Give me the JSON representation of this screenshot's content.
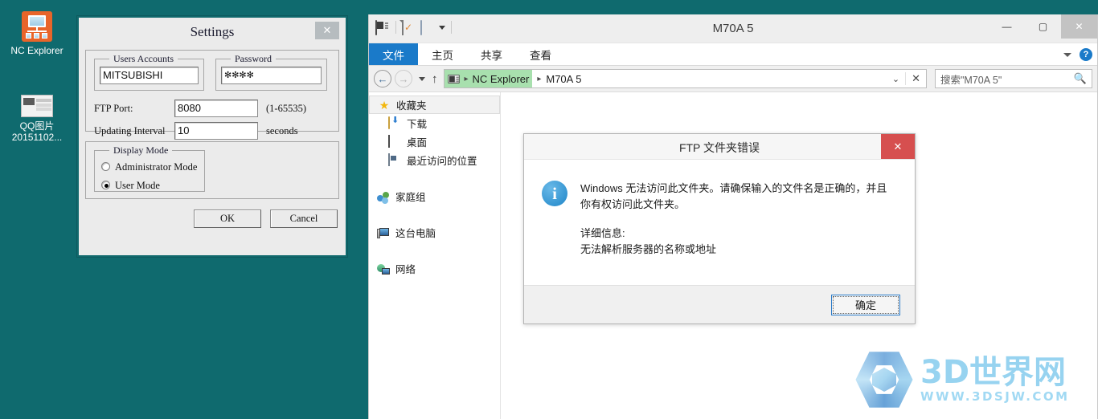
{
  "desktop": {
    "background_color": "#0f6a6e",
    "icons": [
      {
        "name": "NC Explorer",
        "icon": "network-computer-icon"
      },
      {
        "name": "QQ图片\n20151102...",
        "line1": "QQ图片",
        "line2": "20151102...",
        "icon": "image-file-icon"
      }
    ]
  },
  "settings_dialog": {
    "title": "Settings",
    "close_label": "✕",
    "users_accounts": {
      "legend": "Users Accounts",
      "value": "MITSUBISHI"
    },
    "password": {
      "legend": "Password",
      "value": "✻✻✻✻"
    },
    "ftp_port": {
      "label": "FTP Port:",
      "value": "8080",
      "hint": "(1-65535)"
    },
    "updating_interval": {
      "label": "Updating Interval",
      "value": "10",
      "unit": "seconds"
    },
    "display_mode": {
      "legend": "Display Mode",
      "options": [
        {
          "label": "Administrator Mode",
          "selected": false
        },
        {
          "label": "User Mode",
          "selected": true
        }
      ]
    },
    "buttons": {
      "ok": "OK",
      "cancel": "Cancel"
    }
  },
  "explorer": {
    "title": "M70A 5",
    "quick_access": [
      {
        "icon": "explorer-icon"
      },
      {
        "icon": "properties-icon"
      },
      {
        "icon": "new-folder-icon"
      },
      {
        "icon": "customize-dropdown-icon"
      }
    ],
    "window_controls": {
      "minimize": "—",
      "maximize": "▢",
      "close": "✕"
    },
    "ribbon_tabs": [
      {
        "label": "文件",
        "selected": true
      },
      {
        "label": "主页",
        "selected": false
      },
      {
        "label": "共享",
        "selected": false
      },
      {
        "label": "查看",
        "selected": false
      }
    ],
    "ribbon_right": {
      "help_label": "?"
    },
    "address_bar": {
      "back": "←",
      "forward": "→",
      "up": "↑",
      "breadcrumb_highlight": "NC Explorer",
      "breadcrumb_current": "M70A 5",
      "separator": "▸",
      "dropdown": "⌄",
      "refresh_close": "✕"
    },
    "search": {
      "placeholder": "搜索\"M70A 5\"",
      "icon": "search-icon"
    },
    "nav_pane": [
      {
        "label": "收藏夹",
        "icon": "star-icon",
        "selected": true,
        "level": 0
      },
      {
        "label": "下载",
        "icon": "downloads-icon",
        "selected": false,
        "level": 1
      },
      {
        "label": "桌面",
        "icon": "desktop-icon",
        "selected": false,
        "level": 1
      },
      {
        "label": "最近访问的位置",
        "icon": "recent-places-icon",
        "selected": false,
        "level": 1
      },
      {
        "label": "家庭组",
        "icon": "homegroup-icon",
        "selected": false,
        "level": 0
      },
      {
        "label": "这台电脑",
        "icon": "this-pc-icon",
        "selected": false,
        "level": 0
      },
      {
        "label": "网络",
        "icon": "network-icon",
        "selected": false,
        "level": 0
      }
    ]
  },
  "ftp_error_dialog": {
    "title": "FTP 文件夹错误",
    "close_label": "✕",
    "icon": "info-icon",
    "message": "Windows 无法访问此文件夹。请确保输入的文件名是正确的，并且你有权访问此文件夹。",
    "details_label": "详细信息:",
    "details_text": "无法解析服务器的名称或地址",
    "ok_button": "确定",
    "close_color": "#d64f4f"
  },
  "watermark": {
    "title": "3D世界网",
    "url": "WWW.3DSJW.COM",
    "color": "#8fd0ef"
  }
}
